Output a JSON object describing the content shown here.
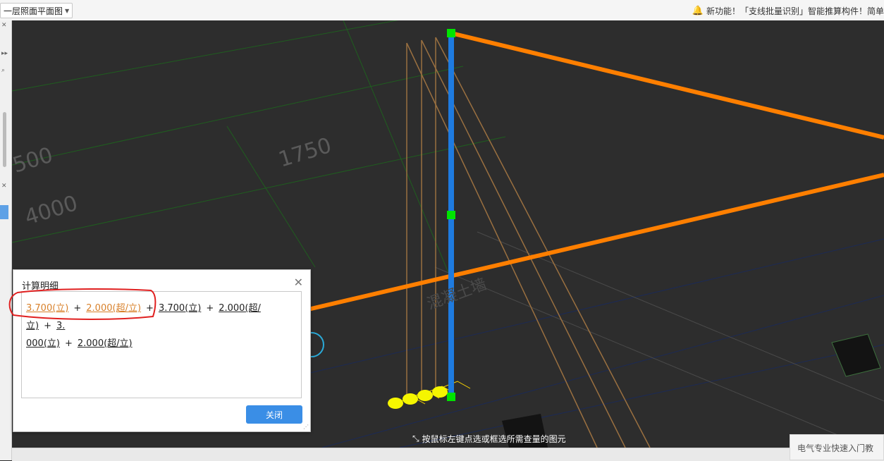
{
  "toolbar": {
    "floor_label": "一层照面平面图"
  },
  "notice": {
    "text": "新功能！「支线批量识别」智能推算构件！简单"
  },
  "canvas": {
    "dims": [
      "500",
      "1750",
      "4000"
    ],
    "faint_label": "混凝土墙",
    "colors": {
      "pipe": "#ff7f00",
      "riser": "#1e7be0",
      "node": "#00e400",
      "bulb": "#f5f500"
    }
  },
  "status": {
    "text": "按鼠标左键点选或框选所需查量的图元"
  },
  "help": {
    "text": "电气专业快速入门教"
  },
  "dialog": {
    "title": "计算明细",
    "terms": [
      "3.700(立)",
      "2.000(超/立)",
      "3.700(立)",
      "2.000(超/立)",
      "3.",
      "000(立)",
      "2.000(超/立)"
    ],
    "plus": "+",
    "close_label": "关闭"
  }
}
